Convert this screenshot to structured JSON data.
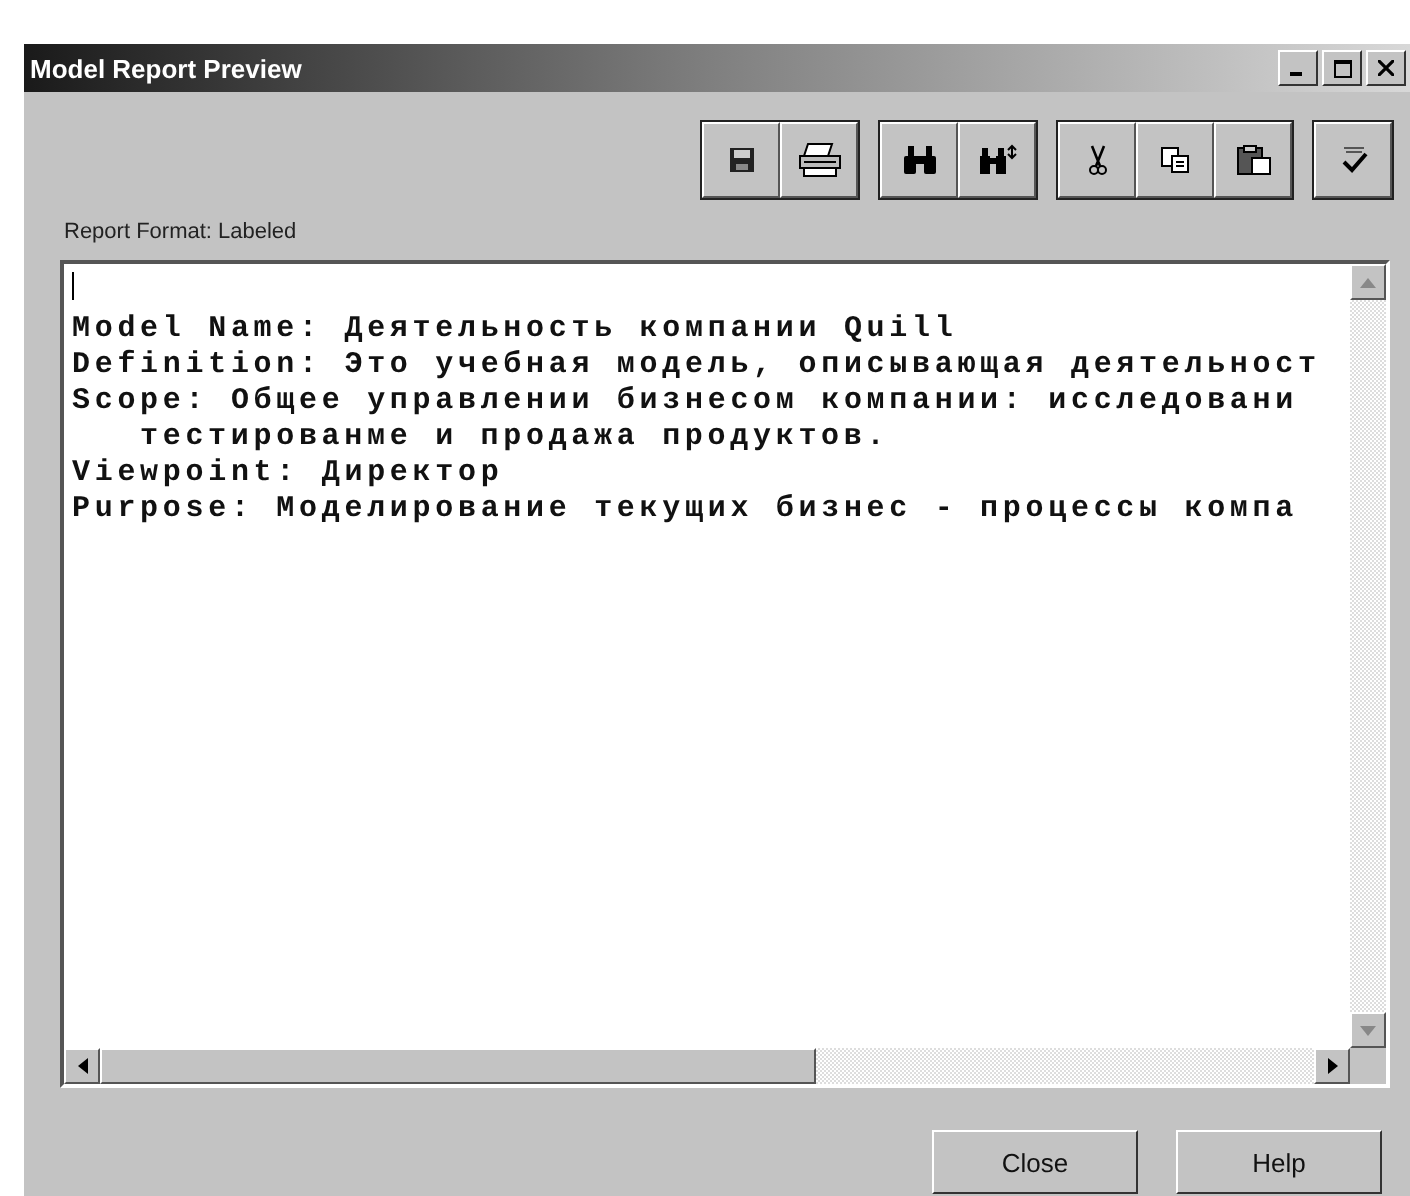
{
  "window": {
    "title": "Model Report Preview",
    "controls": [
      {
        "kind": "minimize"
      },
      {
        "kind": "maximize"
      },
      {
        "kind": "close"
      }
    ]
  },
  "toolbar": [
    {
      "group": [
        {
          "kind": "save"
        },
        {
          "kind": "print"
        }
      ]
    },
    {
      "group": [
        {
          "kind": "find"
        },
        {
          "kind": "find-next"
        }
      ]
    },
    {
      "group": [
        {
          "kind": "cut"
        },
        {
          "kind": "copy"
        },
        {
          "kind": "paste"
        }
      ]
    },
    {
      "group": [
        {
          "kind": "spell"
        }
      ]
    }
  ],
  "report_format_label": "Report Format: Labeled",
  "report_lines": [
    {
      "text": "Model Name: Деятельность компании Quill",
      "continuation": false
    },
    {
      "text": "Definition: Это учебная модель, описывающая деятельност",
      "continuation": false
    },
    {
      "text": "Scope: Общее управлении бизнесом компании: исследовани",
      "continuation": false
    },
    {
      "text": "тестированме и продажа продуктов.",
      "continuation": true
    },
    {
      "text": "Viewpoint: Директор",
      "continuation": false
    },
    {
      "text": "Purpose: Моделирование текущих бизнес - процессы компа",
      "continuation": false
    }
  ],
  "buttons": [
    "Close",
    "Help"
  ]
}
